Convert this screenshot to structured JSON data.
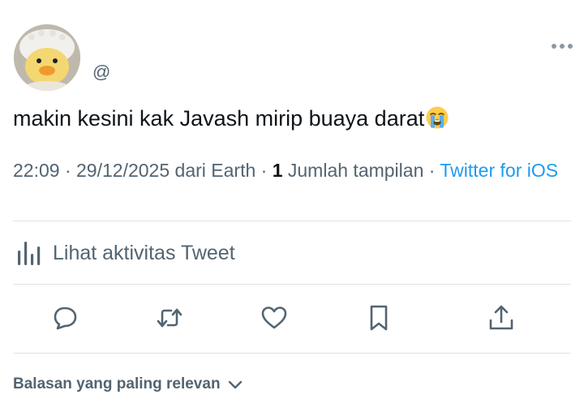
{
  "author": {
    "avatar_icon": "duck-avatar-icon",
    "handle": "@"
  },
  "menu": {
    "icon": "more-horizontal-icon"
  },
  "tweet": {
    "text": "makin kesini kak Javash mirip buaya darat",
    "emoji": "loudly-crying-face-emoji"
  },
  "meta": {
    "time": "22:09",
    "sep1": " · ",
    "date": "29/12/2025",
    "location": " dari Earth",
    "sep2": " · ",
    "views_count": "1",
    "views_label": " Jumlah tampilan",
    "sep3": " · ",
    "source": "Twitter for iOS"
  },
  "activity": {
    "icon": "analytics-bar-chart-icon",
    "label": "Lihat aktivitas Tweet"
  },
  "actions": [
    {
      "icon": "reply-icon"
    },
    {
      "icon": "retweet-icon"
    },
    {
      "icon": "like-heart-icon"
    },
    {
      "icon": "bookmark-icon"
    },
    {
      "icon": "share-icon"
    }
  ],
  "replies": {
    "label": "Balasan yang paling relevan",
    "icon": "chevron-down-icon"
  },
  "colors": {
    "text": "#0f1419",
    "secondary": "#536471",
    "accent": "#1d9bf0",
    "divider": "#dfe3e6"
  }
}
